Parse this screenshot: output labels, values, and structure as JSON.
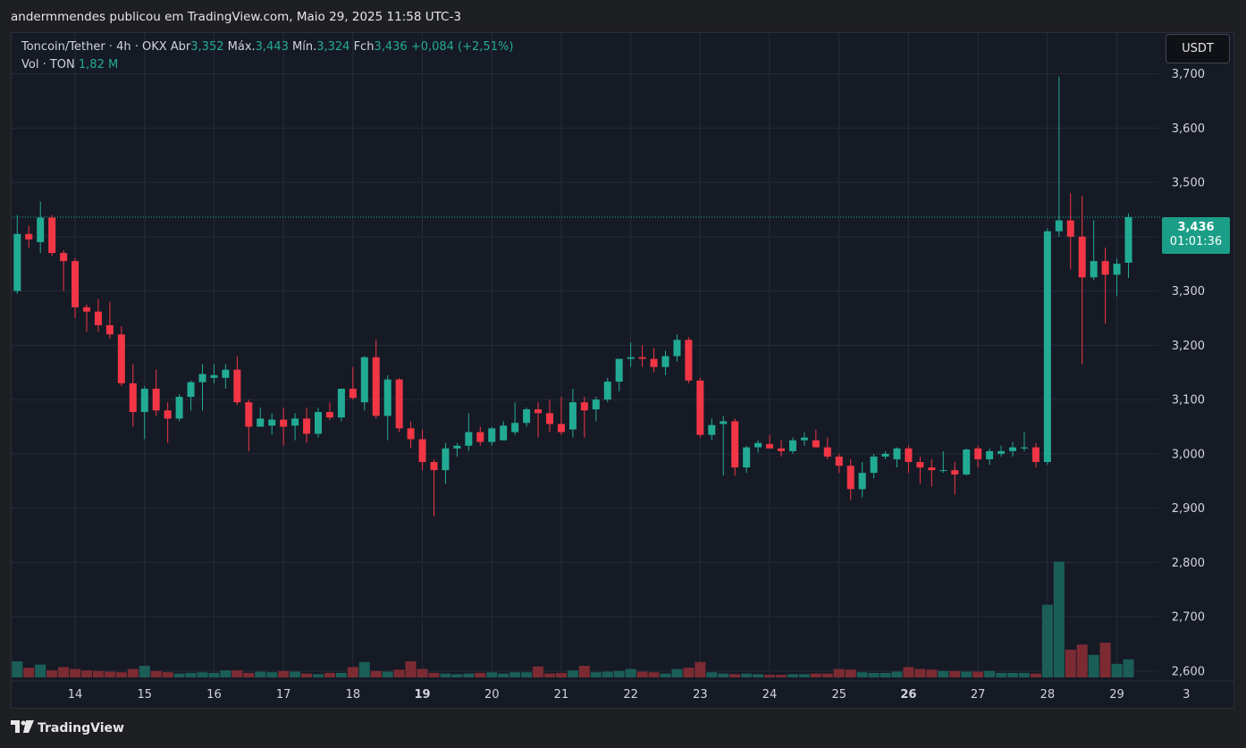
{
  "header": {
    "publisher_line": "andermmendes publicou em TradingView.com, Maio 29, 2025 11:58 UTC-3"
  },
  "legend": {
    "symbol": "Toncoin/Tether · 4h · OKX",
    "open_label": "Abr",
    "open_value": "3,352",
    "high_label": "Máx.",
    "high_value": "3,443",
    "low_label": "Mín.",
    "low_value": "3,324",
    "close_label": "Fch",
    "close_value": "3,436",
    "change": "+0,084 (+2,51%)",
    "vol_label": "Vol · TON",
    "vol_value": "1,82 M"
  },
  "currency_button": {
    "label": "USDT"
  },
  "price_tag": {
    "price": "3,436",
    "countdown": "01:01:36"
  },
  "footer": {
    "brand": "TradingView",
    "logo_icon": "tradingview-logo-icon"
  },
  "colors": {
    "up": "#22ab94",
    "down": "#f23645",
    "vol_up": "#1a5e57",
    "vol_down": "#7d2b33",
    "grid": "#262b38",
    "axis_text": "#d1d4dc"
  },
  "chart_data": {
    "type": "candlestick",
    "title": "Toncoin/Tether · 4h · OKX",
    "yaxis_ticks": [
      "3,700",
      "3,600",
      "3,500",
      "3,400",
      "3,300",
      "3,200",
      "3,100",
      "3,000",
      "2,900",
      "2,800",
      "2,700",
      "2,600"
    ],
    "ylim": [
      2.585,
      3.775
    ],
    "xaxis_ticks": [
      {
        "label": "14",
        "bar": 5,
        "bold": false
      },
      {
        "label": "15",
        "bar": 11,
        "bold": false
      },
      {
        "label": "16",
        "bar": 17,
        "bold": false
      },
      {
        "label": "17",
        "bar": 23,
        "bold": false
      },
      {
        "label": "18",
        "bar": 29,
        "bold": false
      },
      {
        "label": "19",
        "bar": 35,
        "bold": true
      },
      {
        "label": "20",
        "bar": 41,
        "bold": false
      },
      {
        "label": "21",
        "bar": 47,
        "bold": false
      },
      {
        "label": "22",
        "bar": 53,
        "bold": false
      },
      {
        "label": "23",
        "bar": 59,
        "bold": false
      },
      {
        "label": "24",
        "bar": 65,
        "bold": false
      },
      {
        "label": "25",
        "bar": 71,
        "bold": false
      },
      {
        "label": "26",
        "bar": 77,
        "bold": true
      },
      {
        "label": "27",
        "bar": 83,
        "bold": false
      },
      {
        "label": "28",
        "bar": 89,
        "bold": false
      },
      {
        "label": "29",
        "bar": 95,
        "bold": false
      },
      {
        "label": "3",
        "bar": 101,
        "bold": false
      }
    ],
    "last_price": 3.436,
    "candles": [
      {
        "o": 3.3,
        "h": 3.44,
        "l": 3.295,
        "c": 3.405
      },
      {
        "o": 3.405,
        "h": 3.42,
        "l": 3.38,
        "c": 3.395
      },
      {
        "o": 3.39,
        "h": 3.465,
        "l": 3.37,
        "c": 3.435
      },
      {
        "o": 3.435,
        "h": 3.44,
        "l": 3.365,
        "c": 3.37
      },
      {
        "o": 3.37,
        "h": 3.375,
        "l": 3.3,
        "c": 3.355
      },
      {
        "o": 3.355,
        "h": 3.36,
        "l": 3.25,
        "c": 3.27
      },
      {
        "o": 3.27,
        "h": 3.275,
        "l": 3.225,
        "c": 3.262
      },
      {
        "o": 3.262,
        "h": 3.285,
        "l": 3.225,
        "c": 3.237
      },
      {
        "o": 3.237,
        "h": 3.28,
        "l": 3.212,
        "c": 3.22
      },
      {
        "o": 3.22,
        "h": 3.235,
        "l": 3.125,
        "c": 3.13
      },
      {
        "o": 3.13,
        "h": 3.165,
        "l": 3.05,
        "c": 3.077
      },
      {
        "o": 3.077,
        "h": 3.125,
        "l": 3.027,
        "c": 3.12
      },
      {
        "o": 3.12,
        "h": 3.155,
        "l": 3.07,
        "c": 3.08
      },
      {
        "o": 3.08,
        "h": 3.095,
        "l": 3.02,
        "c": 3.065
      },
      {
        "o": 3.065,
        "h": 3.11,
        "l": 3.06,
        "c": 3.105
      },
      {
        "o": 3.105,
        "h": 3.135,
        "l": 3.08,
        "c": 3.132
      },
      {
        "o": 3.132,
        "h": 3.165,
        "l": 3.08,
        "c": 3.147
      },
      {
        "o": 3.14,
        "h": 3.165,
        "l": 3.13,
        "c": 3.145
      },
      {
        "o": 3.14,
        "h": 3.165,
        "l": 3.12,
        "c": 3.155
      },
      {
        "o": 3.155,
        "h": 3.18,
        "l": 3.09,
        "c": 3.095
      },
      {
        "o": 3.095,
        "h": 3.1,
        "l": 3.005,
        "c": 3.05
      },
      {
        "o": 3.05,
        "h": 3.085,
        "l": 3.05,
        "c": 3.065
      },
      {
        "o": 3.052,
        "h": 3.075,
        "l": 3.035,
        "c": 3.063
      },
      {
        "o": 3.063,
        "h": 3.085,
        "l": 3.015,
        "c": 3.05
      },
      {
        "o": 3.052,
        "h": 3.075,
        "l": 3.025,
        "c": 3.065
      },
      {
        "o": 3.065,
        "h": 3.085,
        "l": 3.02,
        "c": 3.037
      },
      {
        "o": 3.037,
        "h": 3.085,
        "l": 3.03,
        "c": 3.077
      },
      {
        "o": 3.077,
        "h": 3.095,
        "l": 3.062,
        "c": 3.067
      },
      {
        "o": 3.067,
        "h": 3.12,
        "l": 3.06,
        "c": 3.12
      },
      {
        "o": 3.12,
        "h": 3.16,
        "l": 3.1,
        "c": 3.103
      },
      {
        "o": 3.095,
        "h": 3.18,
        "l": 3.08,
        "c": 3.178
      },
      {
        "o": 3.178,
        "h": 3.21,
        "l": 3.065,
        "c": 3.07
      },
      {
        "o": 3.07,
        "h": 3.145,
        "l": 3.025,
        "c": 3.137
      },
      {
        "o": 3.137,
        "h": 3.14,
        "l": 3.04,
        "c": 3.047
      },
      {
        "o": 3.047,
        "h": 3.06,
        "l": 3.01,
        "c": 3.027
      },
      {
        "o": 3.027,
        "h": 3.045,
        "l": 2.97,
        "c": 2.985
      },
      {
        "o": 2.985,
        "h": 2.99,
        "l": 2.885,
        "c": 2.97
      },
      {
        "o": 2.97,
        "h": 3.02,
        "l": 2.945,
        "c": 3.01
      },
      {
        "o": 3.01,
        "h": 3.02,
        "l": 2.995,
        "c": 3.015
      },
      {
        "o": 3.015,
        "h": 3.075,
        "l": 3.005,
        "c": 3.04
      },
      {
        "o": 3.04,
        "h": 3.05,
        "l": 3.015,
        "c": 3.022
      },
      {
        "o": 3.022,
        "h": 3.05,
        "l": 3.015,
        "c": 3.047
      },
      {
        "o": 3.025,
        "h": 3.06,
        "l": 3.025,
        "c": 3.052
      },
      {
        "o": 3.04,
        "h": 3.095,
        "l": 3.035,
        "c": 3.057
      },
      {
        "o": 3.057,
        "h": 3.085,
        "l": 3.05,
        "c": 3.082
      },
      {
        "o": 3.082,
        "h": 3.095,
        "l": 3.03,
        "c": 3.075
      },
      {
        "o": 3.075,
        "h": 3.1,
        "l": 3.04,
        "c": 3.055
      },
      {
        "o": 3.055,
        "h": 3.105,
        "l": 3.035,
        "c": 3.04
      },
      {
        "o": 3.045,
        "h": 3.12,
        "l": 3.03,
        "c": 3.095
      },
      {
        "o": 3.095,
        "h": 3.105,
        "l": 3.03,
        "c": 3.08
      },
      {
        "o": 3.082,
        "h": 3.105,
        "l": 3.06,
        "c": 3.1
      },
      {
        "o": 3.1,
        "h": 3.14,
        "l": 3.095,
        "c": 3.133
      },
      {
        "o": 3.133,
        "h": 3.15,
        "l": 3.115,
        "c": 3.175
      },
      {
        "o": 3.175,
        "h": 3.205,
        "l": 3.16,
        "c": 3.178
      },
      {
        "o": 3.178,
        "h": 3.2,
        "l": 3.16,
        "c": 3.175
      },
      {
        "o": 3.175,
        "h": 3.195,
        "l": 3.15,
        "c": 3.16
      },
      {
        "o": 3.16,
        "h": 3.19,
        "l": 3.145,
        "c": 3.18
      },
      {
        "o": 3.18,
        "h": 3.22,
        "l": 3.17,
        "c": 3.21
      },
      {
        "o": 3.21,
        "h": 3.215,
        "l": 3.13,
        "c": 3.135
      },
      {
        "o": 3.135,
        "h": 3.14,
        "l": 3.03,
        "c": 3.035
      },
      {
        "o": 3.035,
        "h": 3.065,
        "l": 3.025,
        "c": 3.053
      },
      {
        "o": 3.055,
        "h": 3.07,
        "l": 2.96,
        "c": 3.06
      },
      {
        "o": 3.06,
        "h": 3.065,
        "l": 2.96,
        "c": 2.975
      },
      {
        "o": 2.975,
        "h": 3.015,
        "l": 2.965,
        "c": 3.012
      },
      {
        "o": 3.012,
        "h": 3.025,
        "l": 3.002,
        "c": 3.02
      },
      {
        "o": 3.018,
        "h": 3.035,
        "l": 3.01,
        "c": 3.01
      },
      {
        "o": 3.01,
        "h": 3.025,
        "l": 2.995,
        "c": 3.005
      },
      {
        "o": 3.005,
        "h": 3.03,
        "l": 3.0,
        "c": 3.025
      },
      {
        "o": 3.025,
        "h": 3.04,
        "l": 3.015,
        "c": 3.03
      },
      {
        "o": 3.025,
        "h": 3.045,
        "l": 3.015,
        "c": 3.012
      },
      {
        "o": 3.012,
        "h": 3.03,
        "l": 2.99,
        "c": 2.995
      },
      {
        "o": 2.995,
        "h": 3.0,
        "l": 2.965,
        "c": 2.978
      },
      {
        "o": 2.978,
        "h": 2.99,
        "l": 2.915,
        "c": 2.935
      },
      {
        "o": 2.935,
        "h": 2.985,
        "l": 2.92,
        "c": 2.965
      },
      {
        "o": 2.965,
        "h": 3.0,
        "l": 2.955,
        "c": 2.995
      },
      {
        "o": 2.995,
        "h": 3.005,
        "l": 2.99,
        "c": 3.0
      },
      {
        "o": 2.99,
        "h": 3.012,
        "l": 2.975,
        "c": 3.01
      },
      {
        "o": 3.01,
        "h": 3.015,
        "l": 2.965,
        "c": 2.985
      },
      {
        "o": 2.985,
        "h": 2.995,
        "l": 2.945,
        "c": 2.975
      },
      {
        "o": 2.975,
        "h": 2.99,
        "l": 2.94,
        "c": 2.97
      },
      {
        "o": 2.97,
        "h": 3.005,
        "l": 2.965,
        "c": 2.97
      },
      {
        "o": 2.97,
        "h": 2.985,
        "l": 2.925,
        "c": 2.962
      },
      {
        "o": 2.962,
        "h": 3.01,
        "l": 2.96,
        "c": 3.008
      },
      {
        "o": 3.01,
        "h": 3.015,
        "l": 2.975,
        "c": 2.99
      },
      {
        "o": 2.99,
        "h": 3.01,
        "l": 2.98,
        "c": 3.005
      },
      {
        "o": 3.0,
        "h": 3.015,
        "l": 2.995,
        "c": 3.005
      },
      {
        "o": 3.005,
        "h": 3.022,
        "l": 2.995,
        "c": 3.012
      },
      {
        "o": 3.01,
        "h": 3.04,
        "l": 3.005,
        "c": 3.012
      },
      {
        "o": 3.012,
        "h": 3.02,
        "l": 2.975,
        "c": 2.985
      },
      {
        "o": 2.985,
        "h": 3.415,
        "l": 2.98,
        "c": 3.41
      },
      {
        "o": 3.41,
        "h": 3.695,
        "l": 3.4,
        "c": 3.43
      },
      {
        "o": 3.43,
        "h": 3.48,
        "l": 3.34,
        "c": 3.4
      },
      {
        "o": 3.4,
        "h": 3.475,
        "l": 3.165,
        "c": 3.325
      },
      {
        "o": 3.325,
        "h": 3.43,
        "l": 3.32,
        "c": 3.355
      },
      {
        "o": 3.355,
        "h": 3.38,
        "l": 3.24,
        "c": 3.33
      },
      {
        "o": 3.33,
        "h": 3.36,
        "l": 3.29,
        "c": 3.35
      },
      {
        "o": 3.352,
        "h": 3.443,
        "l": 3.324,
        "c": 3.436
      }
    ],
    "volume_max_millions": 25,
    "volume": [
      2.5,
      1.5,
      2.0,
      1.1,
      1.6,
      1.3,
      1.1,
      1.0,
      0.9,
      0.8,
      1.3,
      1.8,
      1.0,
      0.8,
      0.6,
      0.7,
      0.8,
      0.7,
      1.1,
      1.1,
      0.7,
      0.9,
      0.8,
      1.0,
      0.9,
      0.6,
      0.5,
      0.7,
      0.7,
      1.6,
      2.4,
      1.0,
      0.9,
      1.2,
      2.5,
      1.3,
      0.7,
      0.6,
      0.5,
      0.6,
      0.7,
      0.8,
      0.6,
      0.8,
      0.8,
      1.7,
      0.6,
      0.7,
      1.1,
      1.8,
      0.8,
      0.9,
      1.0,
      1.3,
      0.9,
      0.8,
      0.6,
      1.3,
      1.5,
      2.4,
      0.8,
      0.6,
      0.5,
      0.6,
      0.5,
      0.4,
      0.4,
      0.5,
      0.5,
      0.6,
      0.6,
      1.3,
      1.2,
      0.8,
      0.7,
      0.7,
      0.9,
      1.6,
      1.3,
      1.2,
      1.0,
      1.0,
      0.9,
      0.9,
      1.0,
      0.7,
      0.7,
      0.7,
      0.6,
      11.3,
      18.0,
      4.3,
      5.1,
      3.5,
      5.4,
      2.1,
      2.8
    ]
  }
}
